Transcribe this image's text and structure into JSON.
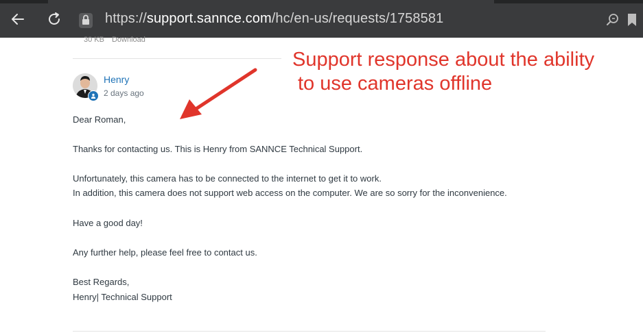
{
  "browser": {
    "url_scheme": "https://",
    "url_host": "support.sannce.com",
    "url_path": "/hc/en-us/requests/1758581",
    "icons": [
      "back-arrow-icon",
      "reload-icon",
      "lock-icon",
      "search-page-icon",
      "bookmark-icon"
    ]
  },
  "attachment": {
    "size": "30 KB",
    "download_label": "Download"
  },
  "comment": {
    "author": "Henry",
    "time": "2 days ago",
    "lines": [
      "Dear Roman,",
      "Thanks for contacting us. This is Henry from SANNCE Technical Support.",
      "Unfortunately, this camera has to be connected to the internet to get it to work.",
      "In addition, this camera does not support web access on the computer. We are so sorry for the inconvenience.",
      "Have a good day!",
      "Any further help, please feel free to contact us.",
      "Best Regards,",
      "Henry| Technical Support"
    ]
  },
  "annotation": {
    "line1": "Support response about the ability",
    "line2": "to use cameras offline",
    "color": "#e0352b"
  },
  "colors": {
    "browser_bar": "#3a3b3d",
    "link_blue": "#1f73b7"
  }
}
